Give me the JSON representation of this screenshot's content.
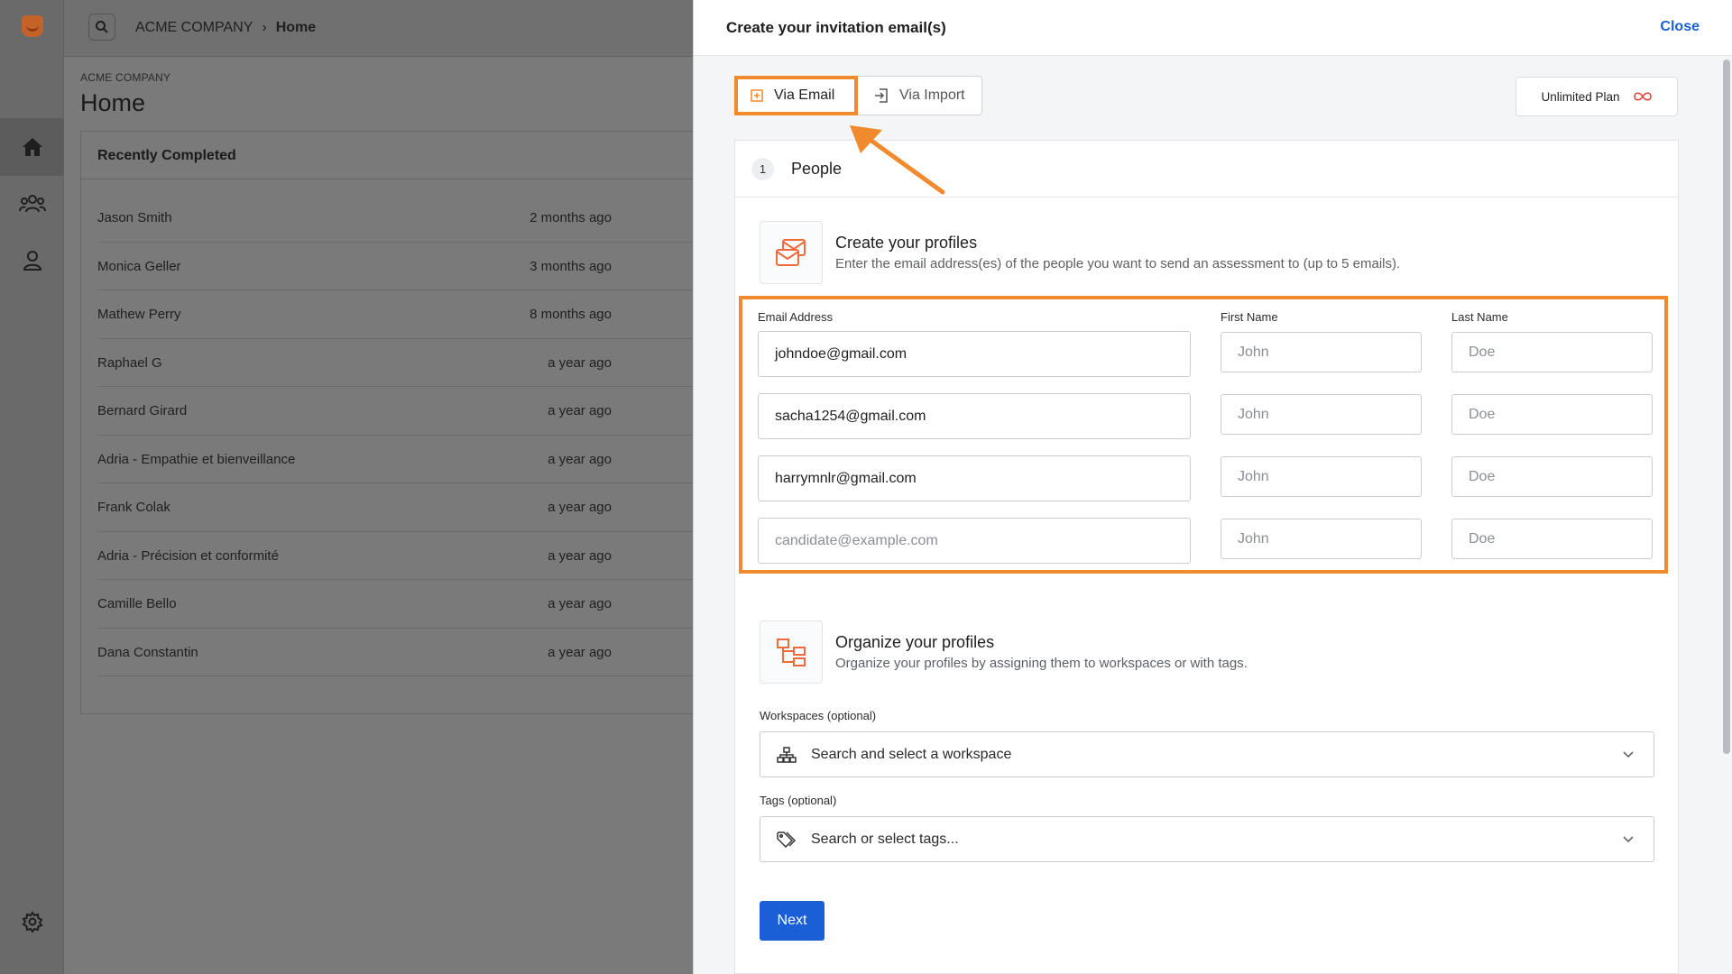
{
  "breadcrumb": {
    "company": "ACME COMPANY",
    "separator": "›",
    "current": "Home"
  },
  "page_header": {
    "company": "ACME COMPANY",
    "title": "Home"
  },
  "recent": {
    "title": "Recently Completed",
    "rows": [
      {
        "name": "Jason Smith",
        "time": "2 months ago"
      },
      {
        "name": "Monica Geller",
        "time": "3 months ago"
      },
      {
        "name": "Mathew Perry",
        "time": "8 months ago"
      },
      {
        "name": "Raphael G",
        "time": "a year ago"
      },
      {
        "name": "Bernard Girard",
        "time": "a year ago"
      },
      {
        "name": "Adria - Empathie et bienveillance",
        "time": "a year ago"
      },
      {
        "name": "Frank Colak",
        "time": "a year ago"
      },
      {
        "name": "Adria - Précision et conformité",
        "time": "a year ago"
      },
      {
        "name": "Camille Bello",
        "time": "a year ago"
      },
      {
        "name": "Dana Constantin",
        "time": "a year ago"
      }
    ]
  },
  "panel": {
    "title": "Create your invitation email(s)",
    "close_label": "Close",
    "tabs": [
      {
        "label": "Via Email",
        "icon": "plus-square-icon"
      },
      {
        "label": "Via Import",
        "icon": "import-icon"
      }
    ],
    "plan": {
      "label": "Unlimited Plan",
      "icon": "infinity-icon"
    },
    "step": {
      "number": "1",
      "label": "People"
    },
    "create": {
      "title": "Create your profiles",
      "subtitle": "Enter the email address(es) of the people you want to send an assessment to (up to 5 emails).",
      "columns": {
        "email": "Email Address",
        "first": "First Name",
        "last": "Last Name"
      },
      "rows": [
        {
          "email": "johndoe@gmail.com",
          "first_placeholder": "John",
          "last_placeholder": "Doe"
        },
        {
          "email": "sacha1254@gmail.com",
          "first_placeholder": "John",
          "last_placeholder": "Doe"
        },
        {
          "email": "harrymnlr@gmail.com",
          "first_placeholder": "John",
          "last_placeholder": "Doe"
        },
        {
          "email_placeholder": "candidate@example.com",
          "first_placeholder": "John",
          "last_placeholder": "Doe"
        }
      ]
    },
    "organize": {
      "title": "Organize your profiles",
      "subtitle": "Organize your profiles by assigning them to workspaces or with tags.",
      "workspaces_label": "Workspaces (optional)",
      "workspaces_placeholder": "Search and select a workspace",
      "tags_label": "Tags (optional)",
      "tags_placeholder": "Search or select tags..."
    },
    "next_label": "Next"
  },
  "colors": {
    "accent": "#F08A2C",
    "primary": "#1A5FD6"
  }
}
